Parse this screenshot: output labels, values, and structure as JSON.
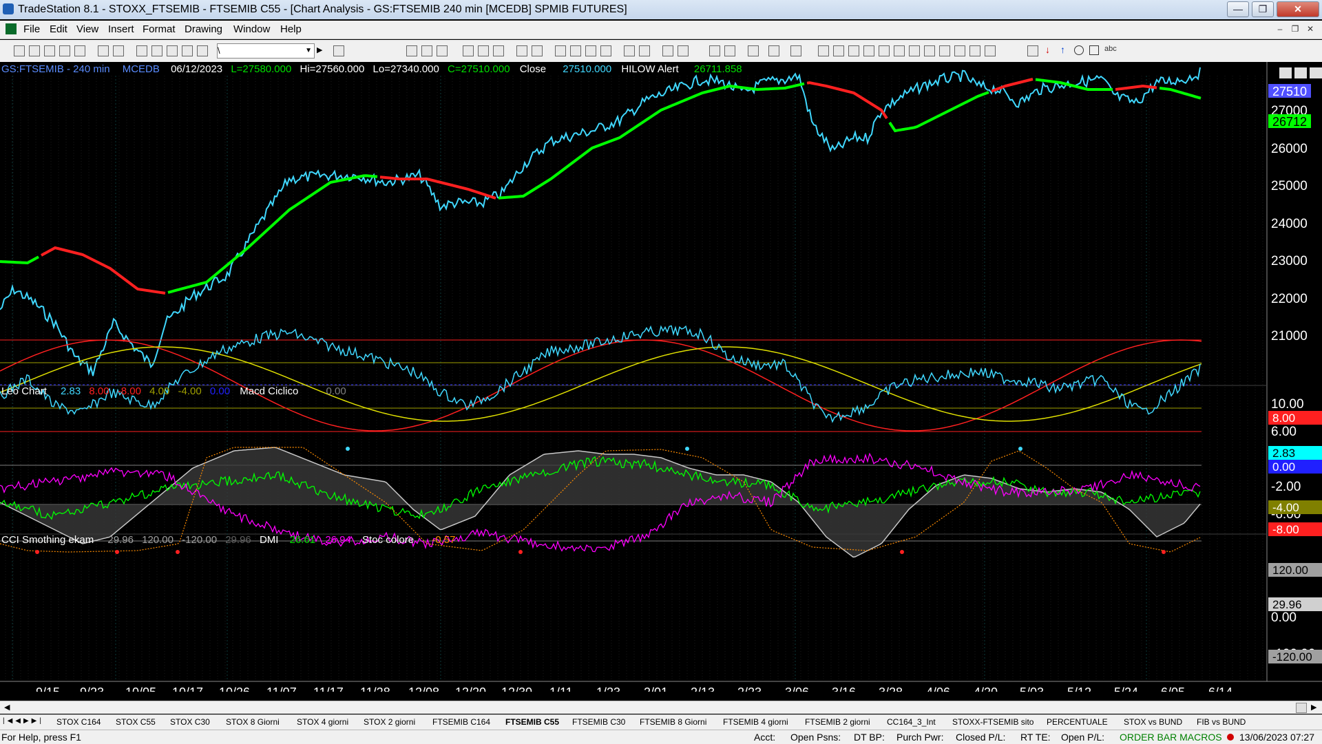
{
  "window": {
    "title": "TradeStation 8.1 - STOXX_FTSEMIB - FTSEMIB C55 - [Chart Analysis - GS:FTSEMIB  240 min  [MCEDB] SPMIB FUTURES]"
  },
  "menu": [
    "File",
    "Edit",
    "View",
    "Insert",
    "Format",
    "Drawing",
    "Window",
    "Help"
  ],
  "toolbar": {
    "combo_value": "\\"
  },
  "price_panel": {
    "symbol": "GS:FTSEMIB - 240 min",
    "session": "MCEDB",
    "date": "06/12/2023",
    "last": "L=27580.000",
    "high": "Hi=27560.000",
    "low": "Lo=27340.000",
    "close": "C=27510.000",
    "close_label": "Close",
    "close_value": "27510.000",
    "alert_label": "HILOW Alert",
    "alert_value": "26711.858",
    "axis_ticks": [
      "27000",
      "26000",
      "25000",
      "24000",
      "23000",
      "22000",
      "21000"
    ],
    "last_price_tag": "27510",
    "alert_tag": "26712"
  },
  "osc_panel": {
    "title": "Leo Chart",
    "values": [
      "2.83",
      "8.00",
      "-8.00",
      "4.00",
      "-4.00",
      "0.00"
    ],
    "indicator": "Macd Ciclico",
    "indicator_value": "0.00",
    "axis_ticks": [
      "10.00",
      "6.00",
      "-2.00",
      "-6.00"
    ],
    "tags": [
      "8.00",
      "2.83",
      "0.00",
      "-4.00",
      "-8.00"
    ]
  },
  "cci_panel": {
    "title": "CCI Smothing ekam",
    "values": [
      "29.96",
      "120.00",
      "-120.00",
      "29.96"
    ],
    "dmi_label": "DMI",
    "dmi_plus": "26.61",
    "dmi_minus": "26.94",
    "stoc_label": "Stoc colore",
    "stoc_value": "-0.57",
    "axis_ticks": [
      "0.00",
      "-100.00"
    ],
    "tags": [
      "120.00",
      "29.96",
      "-120.00"
    ]
  },
  "x_axis": [
    "9/15",
    "9/23",
    "10/05",
    "10/17",
    "10/26",
    "11/07",
    "11/17",
    "11/28",
    "12/08",
    "12/20",
    "12/30",
    "1/11",
    "1/23",
    "2/01",
    "2/13",
    "2/23",
    "3/06",
    "3/16",
    "3/28",
    "4/06",
    "4/20",
    "5/03",
    "5/12",
    "5/24",
    "6/05",
    "6/14"
  ],
  "tabs": [
    "STOX C164",
    "STOX C55",
    "STOX  C30",
    "STOX  8 Giorni",
    "STOX 4 giorni",
    "STOX  2 giorni",
    "FTSEMIB C164",
    "FTSEMIB C55",
    "FTSEMIB C30",
    "FTSEMIB  8 Giorni",
    "FTSEMIB  4 giorni",
    "FTSEMIB  2 giorni",
    "CC164_3_Int",
    "STOXX-FTSEMIB sito",
    "PERCENTUALE",
    "STOX vs BUND",
    "FIB vs BUND"
  ],
  "active_tab": "FTSEMIB C55",
  "status": {
    "help": "For Help, press F1",
    "acct": "Acct:",
    "open_psns": "Open Psns:",
    "dt_bp": "DT BP:",
    "purch_pwr": "Purch Pwr:",
    "closed_pl": "Closed P/L:",
    "rt_te": "RT TE:",
    "open_pl": "Open P/L:",
    "macros": "ORDER BAR  MACROS",
    "datetime": "13/06/2023 07:27"
  },
  "colors": {
    "price": "#40d8ff",
    "trend_up": "#00ff00",
    "trend_down": "#ff2020",
    "dmi_plus": "#00ff00",
    "dmi_minus": "#ff00ff",
    "osc_yellow": "#e0e000",
    "osc_red": "#ff2020",
    "stoc": "#ff8c00"
  }
}
